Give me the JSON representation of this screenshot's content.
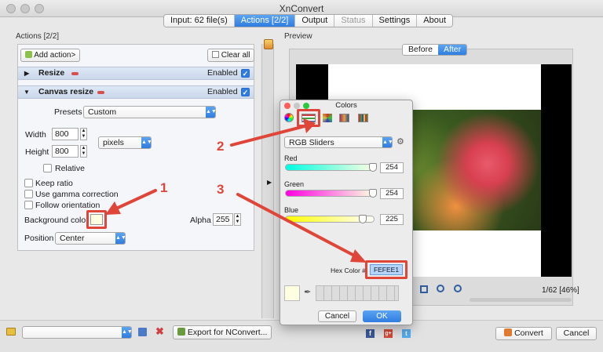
{
  "window": {
    "title": "XnConvert"
  },
  "tabs": [
    {
      "label": "Input: 62 file(s)",
      "state": "normal"
    },
    {
      "label": "Actions [2/2]",
      "state": "active"
    },
    {
      "label": "Output",
      "state": "normal"
    },
    {
      "label": "Status",
      "state": "disabled"
    },
    {
      "label": "Settings",
      "state": "normal"
    },
    {
      "label": "About",
      "state": "normal"
    }
  ],
  "actions_panel": {
    "title": "Actions [2/2]",
    "add_action_label": "Add action>",
    "clear_all_label": "Clear all",
    "resize": {
      "label": "Resize",
      "enabled_label": "Enabled",
      "enabled": true
    },
    "canvas_resize": {
      "label": "Canvas resize",
      "enabled_label": "Enabled",
      "enabled": true,
      "presets_label": "Presets",
      "presets_value": "Custom",
      "width_label": "Width",
      "width_value": "800",
      "height_label": "Height",
      "height_value": "800",
      "unit_value": "pixels",
      "relative_label": "Relative",
      "keep_ratio_label": "Keep ratio",
      "gamma_label": "Use gamma correction",
      "follow_orientation_label": "Follow orientation",
      "bg_color_label": "Background color",
      "bg_color_hex": "#FEFEE1",
      "alpha_label": "Alpha",
      "alpha_value": "255",
      "position_label": "Position",
      "position_value": "Center"
    }
  },
  "preview": {
    "title": "Preview",
    "before_label": "Before",
    "after_label": "After",
    "page_info": "1/62 [46%]"
  },
  "colors_dialog": {
    "title": "Colors",
    "mode_value": "RGB Sliders",
    "red_label": "Red",
    "red_value": "254",
    "green_label": "Green",
    "green_value": "254",
    "blue_label": "Blue",
    "blue_value": "225",
    "hex_label": "Hex Color #",
    "hex_value": "FEFEE1",
    "cancel_label": "Cancel",
    "ok_label": "OK"
  },
  "bottom": {
    "export_label": "Export for NConvert...",
    "convert_label": "Convert",
    "cancel_label": "Cancel"
  },
  "annotations": {
    "one": "1",
    "two": "2",
    "three": "3"
  },
  "colors": {
    "accent": "#2f7de0",
    "annotation_red": "#e0453a",
    "swatch": "#FEFEE1"
  }
}
